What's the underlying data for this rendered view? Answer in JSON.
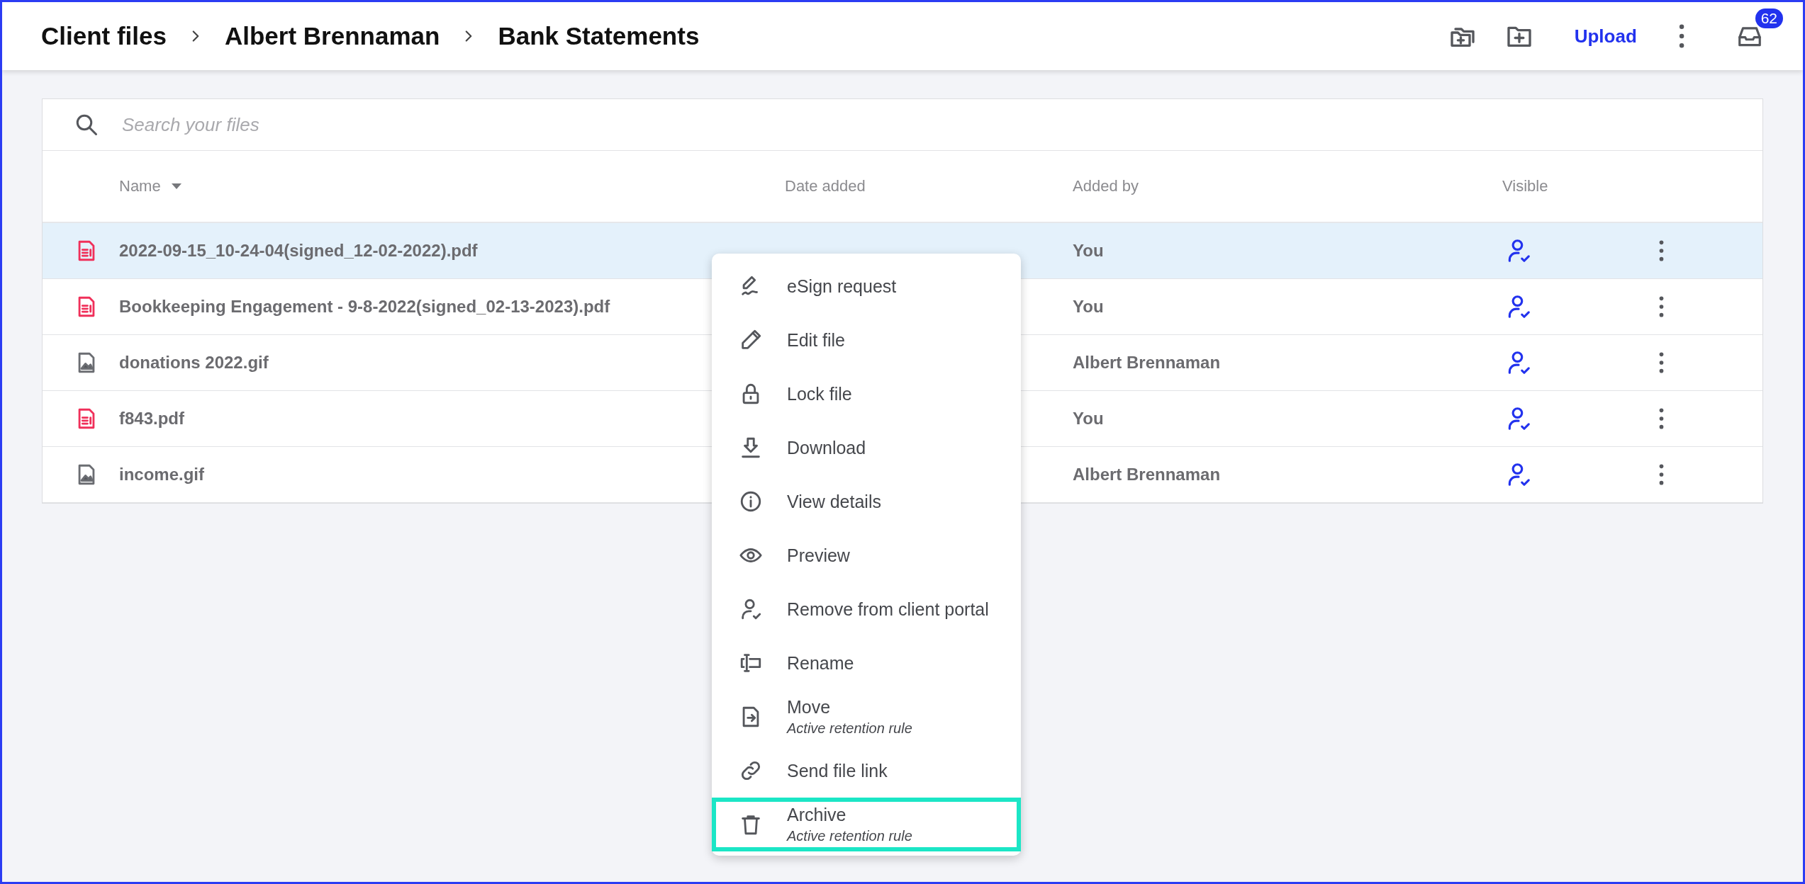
{
  "breadcrumb": [
    {
      "label": "Client files"
    },
    {
      "label": "Albert Brennaman"
    },
    {
      "label": "Bank Statements"
    }
  ],
  "header_actions": {
    "upload": "Upload",
    "notifications_badge": "62"
  },
  "search": {
    "placeholder": "Search your files"
  },
  "table": {
    "columns": [
      {
        "label": "Name",
        "sorted": true
      },
      {
        "label": "Date added",
        "sorted": false
      },
      {
        "label": "Added by",
        "sorted": false
      },
      {
        "label": "Visible",
        "sorted": false
      }
    ],
    "rows": [
      {
        "kind": "pdf",
        "name": "2022-09-15_10-24-04(signed_12-02-2022).pdf",
        "added_by": "You",
        "selected": true
      },
      {
        "kind": "pdf",
        "name": "Bookkeeping Engagement - 9-8-2022(signed_02-13-2023).pdf",
        "added_by": "You",
        "selected": false
      },
      {
        "kind": "image",
        "name": "donations 2022.gif",
        "added_by": "Albert Brennaman",
        "selected": false
      },
      {
        "kind": "pdf",
        "name": "f843.pdf",
        "added_by": "You",
        "selected": false
      },
      {
        "kind": "image",
        "name": "income.gif",
        "added_by": "Albert Brennaman",
        "selected": false
      }
    ]
  },
  "context_menu": {
    "items": [
      {
        "label": "eSign request",
        "highlighted": false
      },
      {
        "label": "Edit file",
        "highlighted": false
      },
      {
        "label": "Lock file",
        "highlighted": false
      },
      {
        "label": "Download",
        "highlighted": false
      },
      {
        "label": "View details",
        "highlighted": false
      },
      {
        "label": "Preview",
        "highlighted": false
      },
      {
        "label": "Remove from client portal",
        "highlighted": false
      },
      {
        "label": "Rename",
        "highlighted": false
      },
      {
        "label": "Move",
        "note": "Active retention rule",
        "highlighted": false
      },
      {
        "label": "Send file link",
        "highlighted": false
      },
      {
        "label": "Archive",
        "note": "Active retention rule",
        "highlighted": true
      }
    ]
  }
}
